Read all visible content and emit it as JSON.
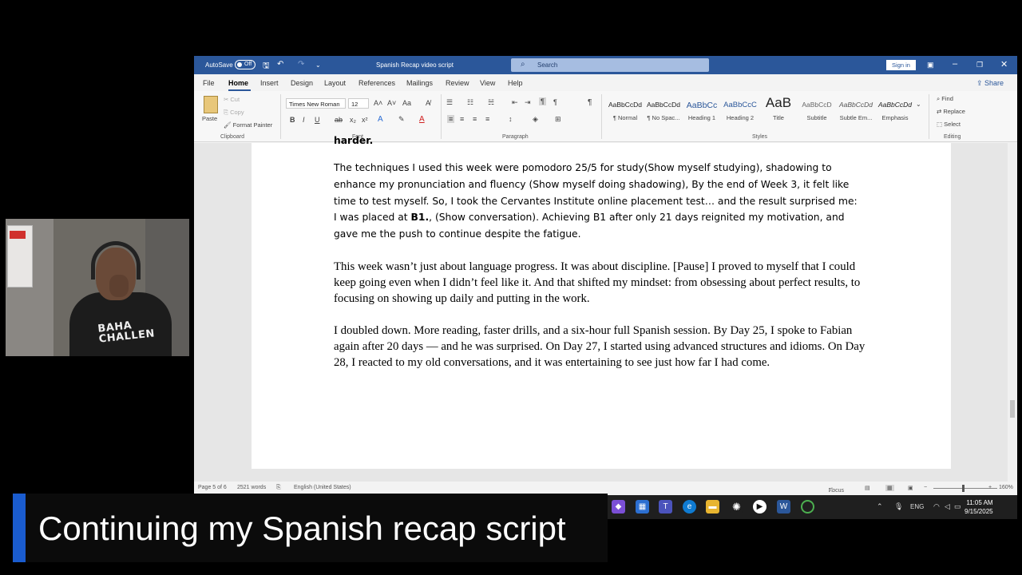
{
  "titlebar": {
    "autosave_label": "AutoSave",
    "autosave_state": "Off",
    "doc_title": "Spanish Recap video script",
    "search_placeholder": "Search",
    "signin_label": "Sign in"
  },
  "menu": {
    "tabs": [
      "File",
      "Home",
      "Insert",
      "Design",
      "Layout",
      "References",
      "Mailings",
      "Review",
      "View",
      "Help"
    ],
    "active_tab": "Home",
    "share_label": "Share"
  },
  "ribbon": {
    "clipboard": {
      "paste": "Paste",
      "cut": "Cut",
      "copy": "Copy",
      "format_painter": "Format Painter",
      "group": "Clipboard"
    },
    "font": {
      "name": "Times New Roman",
      "size": "12",
      "group": "Font"
    },
    "paragraph": {
      "group": "Paragraph"
    },
    "styles": {
      "group": "Styles",
      "items": [
        {
          "preview": "AaBbCcDd",
          "name": "¶ Normal"
        },
        {
          "preview": "AaBbCcDd",
          "name": "¶ No Spac..."
        },
        {
          "preview": "AaBbCc",
          "name": "Heading 1"
        },
        {
          "preview": "AaBbCcC",
          "name": "Heading 2"
        },
        {
          "preview": "AaB",
          "name": "Title"
        },
        {
          "preview": "AaBbCcD",
          "name": "Subtitle"
        },
        {
          "preview": "AaBbCcDd",
          "name": "Subtle Em..."
        },
        {
          "preview": "AaBbCcDd",
          "name": "Emphasis"
        }
      ]
    },
    "editing": {
      "find": "Find",
      "replace": "Replace",
      "select": "Select",
      "group": "Editing"
    }
  },
  "document": {
    "cut_off_line": "harder.",
    "para1_text": "The techniques I used this week were pomodoro 25/5 for study(Show myself studying), shadowing to enhance my pronunciation and fluency (Show myself doing shadowing),  By the end of Week 3, it felt like time to test myself. So, I took the Cervantes Institute online placement test… and the result surprised me: I was placed at ",
    "para1_bold": "B1.",
    "para1_tail": ", (Show conversation). Achieving B1 after only 21 days reignited my motivation, and gave me the push to continue despite the fatigue.",
    "para2": "This week wasn’t just about language progress. It was about discipline. [Pause] I proved to myself that I could keep going even when I didn’t feel like it. And that shifted my mindset: from obsessing about perfect results, to focusing on showing up daily and putting in the work.",
    "para3": "I doubled down. More reading, faster drills, and a six-hour full Spanish session. By Day 25, I spoke to Fabian again after 20 days — and he was surprised. On Day 27, I started using advanced structures and idioms. On Day 28, I reacted to my old conversations, and it was entertaining to see just how far I had come."
  },
  "status": {
    "page": "Page 5 of 6",
    "words": "2521 words",
    "language": "English (United States)",
    "focus": "Focus",
    "zoom": "160%"
  },
  "taskbar": {
    "lang": "ENG",
    "time": "11:05 AM",
    "date": "9/15/2025"
  },
  "webcam": {
    "shirt_text_1": "BAHA",
    "shirt_text_2": "CHALLEN"
  },
  "caption": {
    "text": "Continuing my Spanish recap script",
    "accent": "#1a5ccf"
  }
}
